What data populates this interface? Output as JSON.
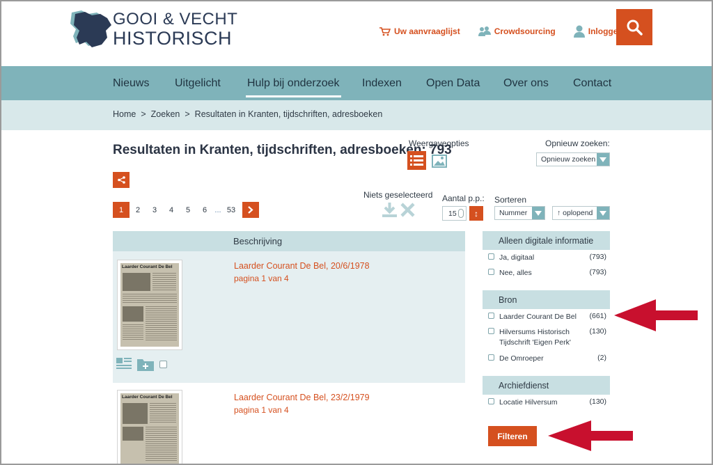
{
  "logo": {
    "line1": "GOOI & VECHT",
    "line2": "HISTORISCH"
  },
  "top_links": [
    {
      "label": "Uw aanvraaglijst",
      "icon": "cart-icon"
    },
    {
      "label": "Crowdsourcing",
      "icon": "people-icon"
    },
    {
      "label": "Inloggen",
      "icon": "user-icon"
    }
  ],
  "nav": [
    "Nieuws",
    "Uitgelicht",
    "Hulp bij onderzoek",
    "Indexen",
    "Open Data",
    "Over ons",
    "Contact"
  ],
  "breadcrumb": [
    "Home",
    "Zoeken",
    "Resultaten in Kranten, tijdschriften, adresboeken"
  ],
  "breadcrumb_sep": ">",
  "results": {
    "title": "Resultaten in Kranten, tijdschriften, adresboeken: 793",
    "view_label": "Weergaveopties",
    "research_label": "Opnieuw zoeken:",
    "research_value": "Opnieuw zoeken",
    "selection_label": "Niets geselecteerd",
    "per_page_label": "Aantal p.p.:",
    "per_page_value": "15",
    "order_symbol": "↕",
    "sort_label": "Sorteren",
    "sort_field": "Nummer",
    "sort_order": "↑ oplopend",
    "pages": [
      "1",
      "2",
      "3",
      "4",
      "5",
      "6",
      "...",
      "53"
    ],
    "column_header": "Beschrijving",
    "items": [
      {
        "title": "Laarder Courant De Bel, 20/6/1978",
        "page": "pagina 1 van 4",
        "masthead": "Laarder Courant De Bel"
      },
      {
        "title": "Laarder Courant De Bel, 23/2/1979",
        "page": "pagina 1 van 4",
        "masthead": "Laarder Courant De Bel"
      }
    ]
  },
  "facets": [
    {
      "heading": "Alleen digitale informatie",
      "options": [
        {
          "label": "Ja, digitaal",
          "count": "(793)"
        },
        {
          "label": "Nee, alles",
          "count": "(793)"
        }
      ]
    },
    {
      "heading": "Bron",
      "options": [
        {
          "label": "Laarder Courant De Bel",
          "count": "(661)"
        },
        {
          "label": "Hilversums Historisch",
          "label2": "Tijdschrift 'Eigen Perk'",
          "count": "(130)"
        },
        {
          "label": "De Omroeper",
          "count": "(2)"
        }
      ]
    },
    {
      "heading": "Archiefdienst",
      "options": [
        {
          "label": "Locatie Hilversum",
          "count": "(130)"
        }
      ]
    }
  ],
  "filter_button": "Filteren",
  "colors": {
    "accent": "#d5501f",
    "nav": "#7fb3ba",
    "annotation_arrow": "#c8102e"
  }
}
